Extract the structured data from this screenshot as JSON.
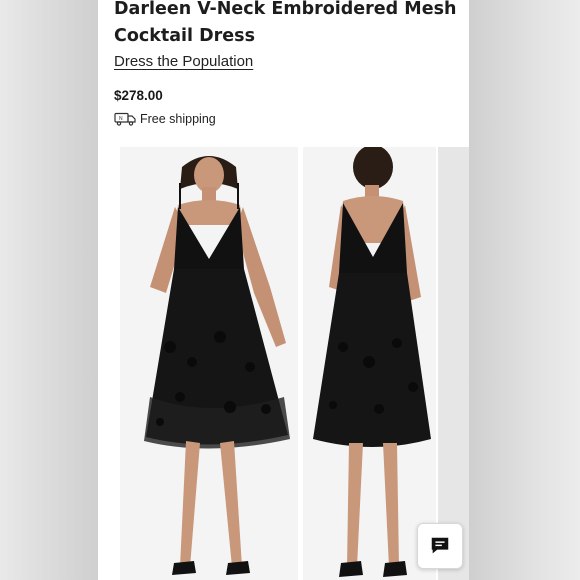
{
  "product": {
    "title": "Darleen V-Neck Embroidered Mesh Cocktail Dress",
    "brand": "Dress the Population",
    "price": "$278.00",
    "shipping": "Free shipping"
  },
  "icons": {
    "shipping": "truck-icon",
    "chat": "chat-icon"
  },
  "colors": {
    "text": "#1d1d1d",
    "dress": "#111111",
    "photo_background": "#f3f3f3"
  }
}
